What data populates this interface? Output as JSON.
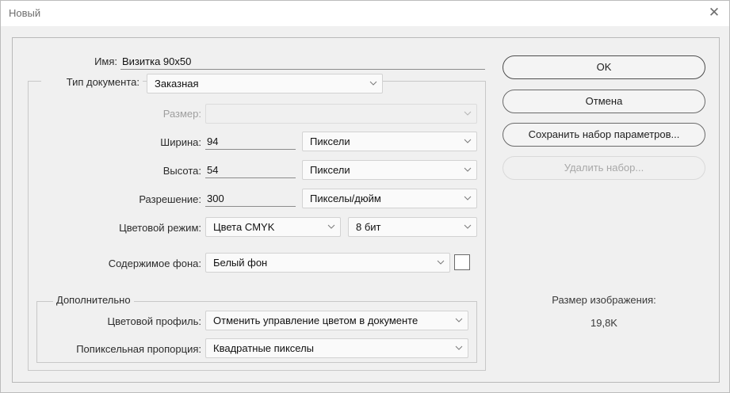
{
  "window": {
    "title": "Новый"
  },
  "name": {
    "label": "Имя:",
    "value": "Визитка 90x50"
  },
  "document_type": {
    "label": "Тип документа:",
    "value": "Заказная"
  },
  "size": {
    "label": "Размер:",
    "value": ""
  },
  "width": {
    "label": "Ширина:",
    "value": "94",
    "unit": "Пиксели"
  },
  "height": {
    "label": "Высота:",
    "value": "54",
    "unit": "Пиксели"
  },
  "resolution": {
    "label": "Разрешение:",
    "value": "300",
    "unit": "Пикселы/дюйм"
  },
  "color_mode": {
    "label": "Цветовой режим:",
    "value": "Цвета CMYK",
    "depth": "8 бит"
  },
  "background": {
    "label": "Содержимое фона:",
    "value": "Белый фон",
    "swatch_color": "#ffffff"
  },
  "advanced": {
    "legend": "Дополнительно",
    "color_profile": {
      "label": "Цветовой профиль:",
      "value": "Отменить управление цветом в документе"
    },
    "pixel_aspect": {
      "label": "Попиксельная пропорция:",
      "value": "Квадратные пикселы"
    }
  },
  "buttons": {
    "ok": "OK",
    "cancel": "Отмена",
    "save_preset": "Сохранить набор параметров...",
    "delete_preset": "Удалить набор..."
  },
  "image_size": {
    "label": "Размер изображения:",
    "value": "19,8K"
  }
}
